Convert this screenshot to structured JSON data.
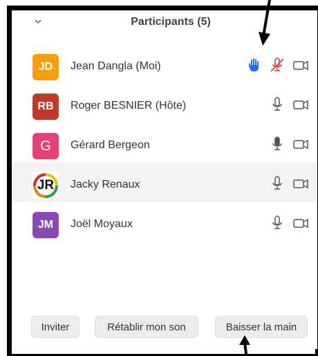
{
  "header": {
    "title": "Participants (5)",
    "collapse_icon": "chevron-down-icon"
  },
  "participants": [
    {
      "initials": "JD",
      "name": "Jean Dangla (Moi)",
      "color": "#f5a00b",
      "hand_raised": true,
      "mic": "muted",
      "video": "off"
    },
    {
      "initials": "RB",
      "name": "Roger BESNIER (Hôte)",
      "color": "#c0392b",
      "hand_raised": false,
      "mic": "on",
      "video": "off"
    },
    {
      "initials": "G",
      "name": "Gérard Bergeon",
      "color": "#e64177",
      "hand_raised": false,
      "mic": "speaking",
      "video": "off"
    },
    {
      "initials": "JR",
      "name": "Jacky Renaux",
      "color": "#ffffff",
      "hand_raised": false,
      "mic": "on",
      "video": "off"
    },
    {
      "initials": "JM",
      "name": "Joël Moyaux",
      "color": "#8a49b5",
      "hand_raised": false,
      "mic": "on",
      "video": "off"
    }
  ],
  "footer": {
    "invite_label": "Inviter",
    "unmute_label": "Rétablir mon son",
    "lower_hand_label": "Baisser la main"
  },
  "colors": {
    "raise_hand": "#1a73e8",
    "muted": "#e03b3b",
    "icon": "#555555"
  }
}
